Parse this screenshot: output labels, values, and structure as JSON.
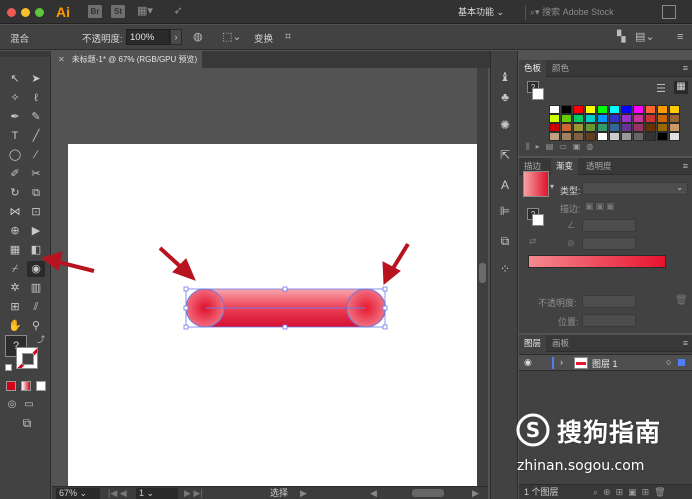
{
  "app": {
    "logo": "Ai",
    "st_badge": "St",
    "workspace": "基本功能",
    "search_placeholder": "搜索 Adobe Stock"
  },
  "control_bar": {
    "mixed_label": "混合",
    "opacity_label": "不透明度:",
    "opacity_value": "100%",
    "transform_label": "变换"
  },
  "document": {
    "tab_title": "未标题-1* @ 67% (RGB/GPU 预览)"
  },
  "tools": {
    "fill_question": "?"
  },
  "status": {
    "zoom": "67%",
    "page": "1",
    "mode": "选择"
  },
  "swatches_panel": {
    "tabs": [
      "色板",
      "颜色"
    ],
    "question": "?",
    "colors": [
      "#ffffff",
      "#000000",
      "#ff0000",
      "#ffff00",
      "#00ff00",
      "#00ffff",
      "#0000ff",
      "#ff00ff",
      "#ff6633",
      "#ff9900",
      "#ffcc00",
      "#ccff00",
      "#66cc00",
      "#00cc66",
      "#00cccc",
      "#0099ff",
      "#3333cc",
      "#9933cc",
      "#cc3399",
      "#cc3333",
      "#cc6600",
      "#996633",
      "#cc0000",
      "#cc6633",
      "#999933",
      "#669933",
      "#339966",
      "#336699",
      "#663399",
      "#993366",
      "#663300",
      "#996600",
      "#cc9966",
      "#c0a080",
      "#a08060",
      "#806040",
      "#604020",
      "#ffffff",
      "#cccccc",
      "#999999",
      "#666666",
      "#333333",
      "#000000",
      "#e0e0e0"
    ]
  },
  "gradient_panel": {
    "tabs": [
      "描边",
      "渐变",
      "透明度"
    ],
    "type_label": "类型:",
    "stroke_label": "描边:",
    "opacity_label": "不透明度:",
    "position_label": "位置:",
    "question": "?",
    "start_color": "#f58990",
    "end_color": "#e8132d"
  },
  "layers_panel": {
    "tabs": [
      "图层",
      "画板"
    ],
    "layer_name": "图层 1",
    "footer": "1 个图层"
  },
  "watermark": {
    "title": "搜狗指南",
    "url": "zhinan.sogou.com"
  }
}
